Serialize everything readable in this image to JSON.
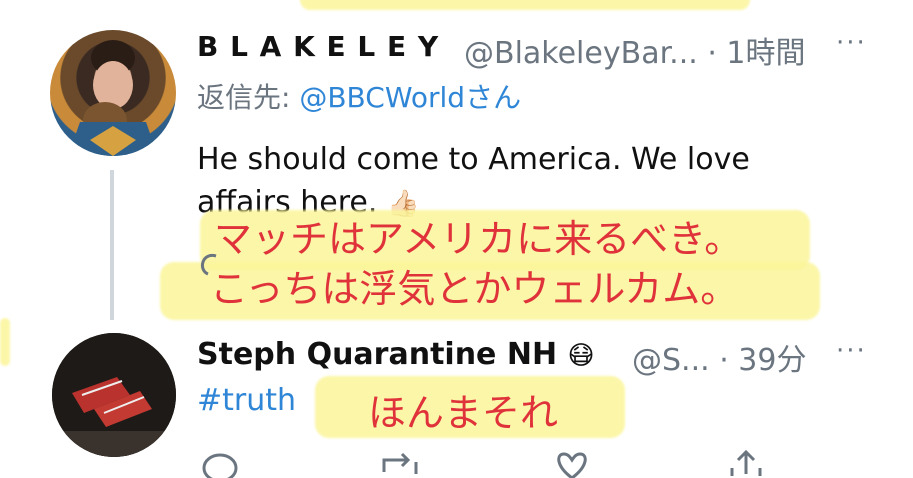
{
  "tweets": [
    {
      "display_name": "B L A K E L E Y",
      "handle": "@BlakeleyBar...",
      "time": "· 1時間",
      "more": "···",
      "reply_prefix": "返信先: ",
      "reply_to": "@BBCWorld",
      "reply_suffix": "さん",
      "text_line1": "He should come to America. We love",
      "text_line2": "affairs here.",
      "emoji": "👍🏻",
      "caption_line1": "マッチはアメリカに来るべき。",
      "caption_line2": "こっちは浮気とかウェルカム。"
    },
    {
      "display_name": "Steph Quarantine NH",
      "emoji": "😷",
      "handle": "@S...",
      "time": "· 39分",
      "more": "···",
      "hashtag": "#truth",
      "caption": "ほんまそれ"
    }
  ],
  "colors": {
    "link": "#2f86d6",
    "highlight": "#fbf59a",
    "meta": "#6b7580"
  }
}
